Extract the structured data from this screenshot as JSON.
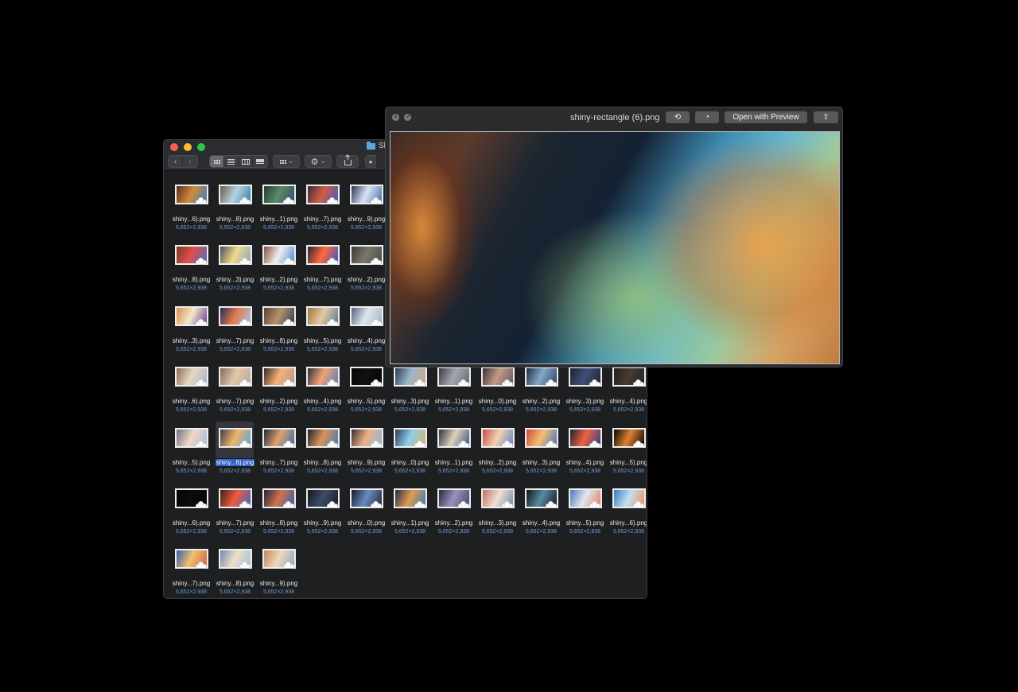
{
  "finder": {
    "title": "Sl",
    "items": [
      {
        "name": "shiny...6).png",
        "dims": "5,652×2,938",
        "colors": [
          "#5a2c25",
          "#d28a3b",
          "#3f7db5"
        ]
      },
      {
        "name": "shiny...8).png",
        "dims": "5,652×2,938",
        "colors": [
          "#6d5c43",
          "#b6d4e6",
          "#3a7ea4"
        ]
      },
      {
        "name": "shiny...1).png",
        "dims": "5,652×2,938",
        "colors": [
          "#263f2c",
          "#5a8a6b",
          "#2c4f6a"
        ]
      },
      {
        "name": "shiny...7).png",
        "dims": "5,652×2,938",
        "colors": [
          "#3b2b3a",
          "#d25c45",
          "#3c5ec2"
        ]
      },
      {
        "name": "shiny...9).png",
        "dims": "5,652×2,938",
        "colors": [
          "#2a3658",
          "#d8e4f0",
          "#4d6fb0"
        ]
      },
      {
        "name": "shiny...8).png",
        "dims": "5,652×2,938",
        "colors": [
          "#7a3a28",
          "#e04f4a",
          "#4e6dc2"
        ]
      },
      {
        "name": "shiny...3).png",
        "dims": "5,652×2,938",
        "colors": [
          "#4a4c57",
          "#f3d98a",
          "#8aa8c3"
        ]
      },
      {
        "name": "shiny...2).png",
        "dims": "5,652×2,938",
        "colors": [
          "#8c4c3a",
          "#f0f0f0",
          "#4b8ad0"
        ]
      },
      {
        "name": "shiny...7).png",
        "dims": "5,652×2,938",
        "colors": [
          "#2b2332",
          "#ff6a3a",
          "#3b57c2"
        ]
      },
      {
        "name": "shiny...2).png",
        "dims": "5,652×2,938",
        "colors": [
          "#3a3d3a",
          "#7c7666",
          "#4a4c4a"
        ]
      },
      {
        "name": "shiny...3).png",
        "dims": "5,652×2,938",
        "colors": [
          "#d88d4c",
          "#f5e8c8",
          "#6f3f97"
        ]
      },
      {
        "name": "shiny...7).png",
        "dims": "5,652×2,938",
        "colors": [
          "#1f2a5e",
          "#e37a4b",
          "#a3c4e8"
        ]
      },
      {
        "name": "shiny...8).png",
        "dims": "5,652×2,938",
        "colors": [
          "#5b4233",
          "#b7926b",
          "#2f3d4a"
        ]
      },
      {
        "name": "shiny...5).png",
        "dims": "5,652×2,938",
        "colors": [
          "#a37444",
          "#e3c9a0",
          "#597a96"
        ]
      },
      {
        "name": "shiny...4).png",
        "dims": "5,652×2,938",
        "colors": [
          "#566478",
          "#dfe7ee",
          "#9fb2c8"
        ]
      },
      {
        "name": "shiny...6).png",
        "dims": "5,652×2,938",
        "colors": [
          "#8a6b56",
          "#e6d7c2",
          "#a3b6c5"
        ]
      },
      {
        "name": "shiny...7).png",
        "dims": "5,652×2,938",
        "colors": [
          "#7d6d63",
          "#e4c7a6",
          "#b9a89a"
        ]
      },
      {
        "name": "shiny...2).png",
        "dims": "5,652×2,938",
        "colors": [
          "#3a2a22",
          "#f2b07a",
          "#b79a86"
        ]
      },
      {
        "name": "shiny...4).png",
        "dims": "5,652×2,938",
        "colors": [
          "#2a2f38",
          "#f0a37a",
          "#5d7cb0"
        ]
      },
      {
        "name": "shiny...5).png",
        "dims": "5,652×2,938",
        "colors": [
          "#050505",
          "#101010",
          "#050505"
        ]
      },
      {
        "name": "shiny...3).png",
        "dims": "5,652×2,938",
        "colors": [
          "#2d3850",
          "#9ab7c8",
          "#d2a57f"
        ]
      },
      {
        "name": "shiny...1).png",
        "dims": "5,652×2,938",
        "colors": [
          "#3c3a40",
          "#a3a8b0",
          "#676a70"
        ]
      },
      {
        "name": "shiny...0).png",
        "dims": "5,652×2,938",
        "colors": [
          "#3d3036",
          "#c29a86",
          "#6a5a60"
        ]
      },
      {
        "name": "shiny...2).png",
        "dims": "5,652×2,938",
        "colors": [
          "#1f2d45",
          "#86a7c6",
          "#2f4463"
        ]
      },
      {
        "name": "shiny...3).png",
        "dims": "5,652×2,938",
        "colors": [
          "#1d2130",
          "#3e5178",
          "#1f2333"
        ]
      },
      {
        "name": "shiny...4).png",
        "dims": "5,652×2,938",
        "colors": [
          "#1c1e24",
          "#4a3b2e",
          "#20232a"
        ]
      },
      {
        "name": "shiny...5).png",
        "dims": "5,652×2,938",
        "colors": [
          "#6b6f8a",
          "#f0d7c2",
          "#a8b9e0"
        ]
      },
      {
        "name": "shiny...6).png",
        "dims": "5,652×2,938",
        "colors": [
          "#3a3f4c",
          "#f2b36a",
          "#57a7d4"
        ]
      },
      {
        "name": "shiny...7).png",
        "dims": "5,652×2,938",
        "colors": [
          "#202a3a",
          "#e0a070",
          "#3b6fa8"
        ]
      },
      {
        "name": "shiny...8).png",
        "dims": "5,652×2,938",
        "colors": [
          "#1c2030",
          "#d8945a",
          "#4a78b8"
        ]
      },
      {
        "name": "shiny...9).png",
        "dims": "5,652×2,938",
        "colors": [
          "#3a2c34",
          "#f0b080",
          "#8ab6e0"
        ]
      },
      {
        "name": "shiny...0).png",
        "dims": "5,652×2,938",
        "colors": [
          "#2c3a5a",
          "#8ad0e8",
          "#e0b070"
        ]
      },
      {
        "name": "shiny...1).png",
        "dims": "5,652×2,938",
        "colors": [
          "#2a3040",
          "#e0d0b8",
          "#3c5a8a"
        ]
      },
      {
        "name": "shiny...2).png",
        "dims": "5,652×2,938",
        "colors": [
          "#c84b3f",
          "#f4d0b0",
          "#6b86c8"
        ]
      },
      {
        "name": "shiny...3).png",
        "dims": "5,652×2,938",
        "colors": [
          "#d04840",
          "#f0c070",
          "#5070c0"
        ]
      },
      {
        "name": "shiny...4).png",
        "dims": "5,652×2,938",
        "colors": [
          "#1a2034",
          "#f06040",
          "#304080"
        ]
      },
      {
        "name": "shiny...5).png",
        "dims": "5,652×2,938",
        "colors": [
          "#050505",
          "#e08030",
          "#050505"
        ]
      },
      {
        "name": "shiny...6).png",
        "dims": "5,652×2,938",
        "colors": [
          "#040404",
          "#0c0c0c",
          "#040404"
        ]
      },
      {
        "name": "shiny...7).png",
        "dims": "5,652×2,938",
        "colors": [
          "#3a2220",
          "#f05a3a",
          "#3b68c8"
        ]
      },
      {
        "name": "shiny...8).png",
        "dims": "5,652×2,938",
        "colors": [
          "#202638",
          "#d07050",
          "#3d5ea8"
        ]
      },
      {
        "name": "shiny...9).png",
        "dims": "5,652×2,938",
        "colors": [
          "#15171c",
          "#3e4c6a",
          "#1a1d24"
        ]
      },
      {
        "name": "shiny...0).png",
        "dims": "5,652×2,938",
        "colors": [
          "#151b2a",
          "#6a8ac0",
          "#20283a"
        ]
      },
      {
        "name": "shiny...1).png",
        "dims": "5,652×2,938",
        "colors": [
          "#1e2c42",
          "#e09a50",
          "#3a7ab0"
        ]
      },
      {
        "name": "shiny...2).png",
        "dims": "5,652×2,938",
        "colors": [
          "#252a3e",
          "#9a92b8",
          "#3a4a7a"
        ]
      },
      {
        "name": "shiny...3).png",
        "dims": "5,652×2,938",
        "colors": [
          "#c07060",
          "#f0e0d0",
          "#7a8ab0"
        ]
      },
      {
        "name": "shiny...4).png",
        "dims": "5,652×2,938",
        "colors": [
          "#101418",
          "#5a8aa0",
          "#141a22"
        ]
      },
      {
        "name": "shiny...5).png",
        "dims": "5,652×2,938",
        "colors": [
          "#4a7ab8",
          "#e0e8f0",
          "#e08060"
        ]
      },
      {
        "name": "shiny...6).png",
        "dims": "5,652×2,938",
        "colors": [
          "#3a78c0",
          "#c0e0f0",
          "#f09060"
        ]
      },
      {
        "name": "shiny...7).png",
        "dims": "5,652×2,938",
        "colors": [
          "#3060b0",
          "#f0c070",
          "#d06040"
        ]
      },
      {
        "name": "shiny...8).png",
        "dims": "5,652×2,938",
        "colors": [
          "#6a8ab0",
          "#f0e0c8",
          "#a0c0e0"
        ]
      },
      {
        "name": "shiny...9).png",
        "dims": "5,652×2,938",
        "colors": [
          "#c08858",
          "#f0d8b8",
          "#88a8c8"
        ]
      }
    ],
    "selected_index": 27
  },
  "quicklook": {
    "title": "shiny-rectangle (6).png",
    "open_label": "Open with Preview",
    "close_icon": "close-icon",
    "fullscreen_icon": "fullscreen-icon"
  }
}
